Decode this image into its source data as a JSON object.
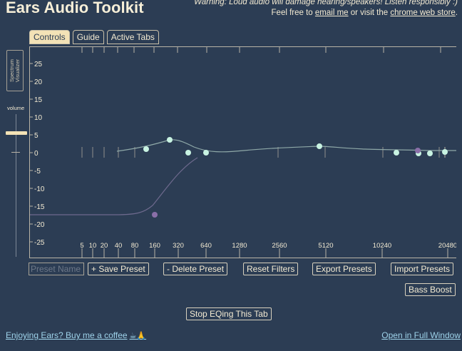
{
  "app": {
    "title": "Ears Audio Toolkit"
  },
  "header": {
    "warning": "Warning: Loud audio will damage hearing/speakers! Listen responsibly :)",
    "feel_free": "Feel free to",
    "email_link": "email me",
    "or_visit": "or visit the",
    "store_link": "chrome web store",
    "period": "."
  },
  "tabs": [
    {
      "label": "Controls",
      "active": true
    },
    {
      "label": "Guide",
      "active": false
    },
    {
      "label": "Active Tabs",
      "active": false
    }
  ],
  "sidebar": {
    "spectrum_line1": "Spectrum",
    "spectrum_line2": "Visualizer",
    "volume_label": "volume",
    "volume_level": 0.82
  },
  "eq_plot": {
    "y_ticks": [
      "25",
      "20",
      "15",
      "10",
      "5",
      "0",
      "-5",
      "-10",
      "-15",
      "-20",
      "-25"
    ],
    "x_labels": [
      "5",
      "10",
      "20",
      "40",
      "80",
      "160",
      "320",
      "640",
      "1280",
      "2560",
      "5120",
      "10240",
      "20480"
    ],
    "colors": {
      "curve": "#8fa9a8",
      "filter_dot": "#c8f3e2",
      "highpass_curve": "#6e6a8e",
      "purple_dot": "#8a6fa8",
      "axis": "#b9b4a6"
    }
  },
  "controls": {
    "preset_placeholder": "Preset Name",
    "save_preset": "+ Save Preset",
    "delete_preset": "- Delete Preset",
    "reset_filters": "Reset Filters",
    "export_presets": "Export Presets",
    "import_presets": "Import Presets",
    "bass_boost": "Bass Boost",
    "stop_eq": "Stop EQing This Tab"
  },
  "footer": {
    "coffee_text": "Enjoying Ears? Buy me a coffee",
    "coffee_emoji": "☕🙏",
    "full_window": "Open in Full Window"
  }
}
